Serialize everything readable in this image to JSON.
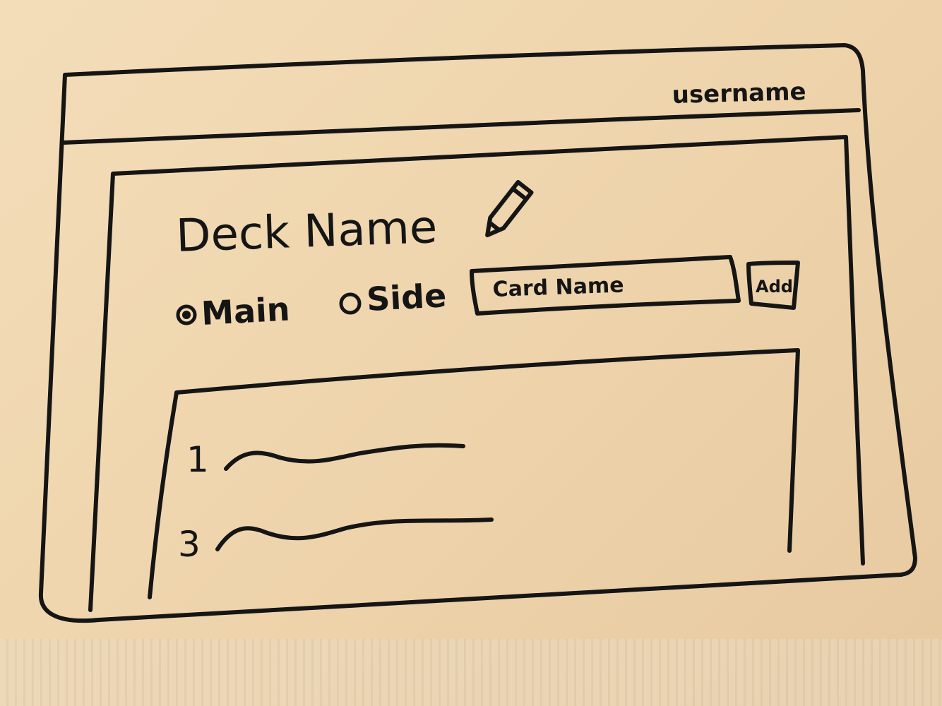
{
  "header": {
    "username": "username"
  },
  "deck": {
    "name": "Deck Name",
    "edit_icon": "pencil-icon"
  },
  "board_selector": {
    "options": [
      {
        "label": "Main",
        "selected": true
      },
      {
        "label": "Side",
        "selected": false
      }
    ]
  },
  "card_input": {
    "placeholder": "Card Name"
  },
  "add_button": {
    "label": "Add"
  },
  "card_list": {
    "items": [
      {
        "quantity": "1"
      },
      {
        "quantity": "3"
      }
    ]
  }
}
